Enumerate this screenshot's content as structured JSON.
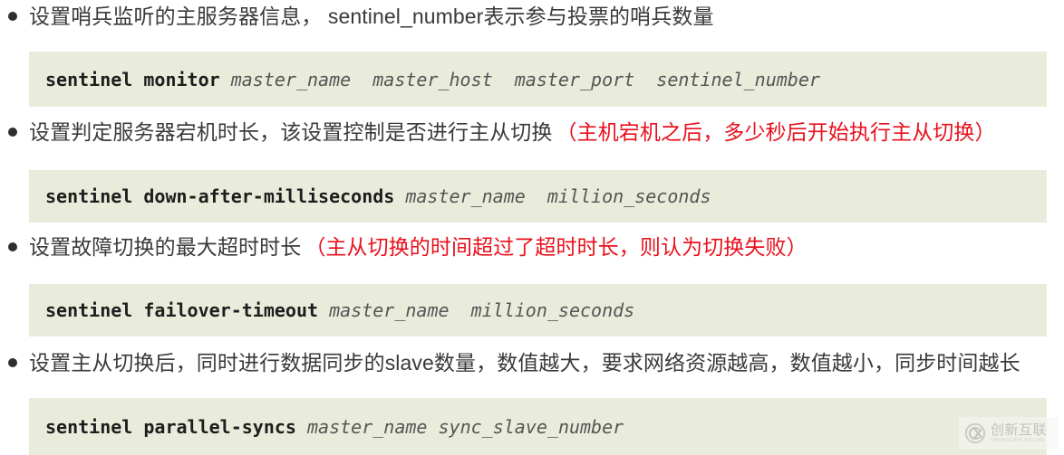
{
  "page": {
    "background_color": "#ffffff",
    "code_block_background": "#e9ecdb",
    "note_color": "#e8111d",
    "text_color": "#3a3a3a"
  },
  "items": [
    {
      "bullet_main": "设置哨兵监听的主服务器信息，  sentinel_number表示参与投票的哨兵数量",
      "bullet_note": "",
      "code": {
        "command": "sentinel monitor",
        "args": " master_name  master_host  master_port  sentinel_number"
      }
    },
    {
      "bullet_main": "设置判定服务器宕机时长，该设置控制是否进行主从切换",
      "bullet_note": "（主机宕机之后，多少秒后开始执行主从切换）",
      "code": {
        "command": "sentinel down-after-milliseconds",
        "args": " master_name  million_seconds"
      }
    },
    {
      "bullet_main": "设置故障切换的最大超时时长",
      "bullet_note": "（主从切换的时间超过了超时时长，则认为切换失败）",
      "code": {
        "command": "sentinel failover-timeout",
        "args": " master_name  million_seconds"
      }
    },
    {
      "bullet_main": "设置主从切换后，同时进行数据同步的slave数量，数值越大，要求网络资源越高，数值越小，同步时间越长",
      "bullet_note": "",
      "code": {
        "command": "sentinel parallel-syncs",
        "args": " master_name sync_slave_number"
      }
    }
  ],
  "watermark": {
    "brand_cn": "创新互联",
    "brand_en": "CHUANGXIN HULIAN"
  }
}
